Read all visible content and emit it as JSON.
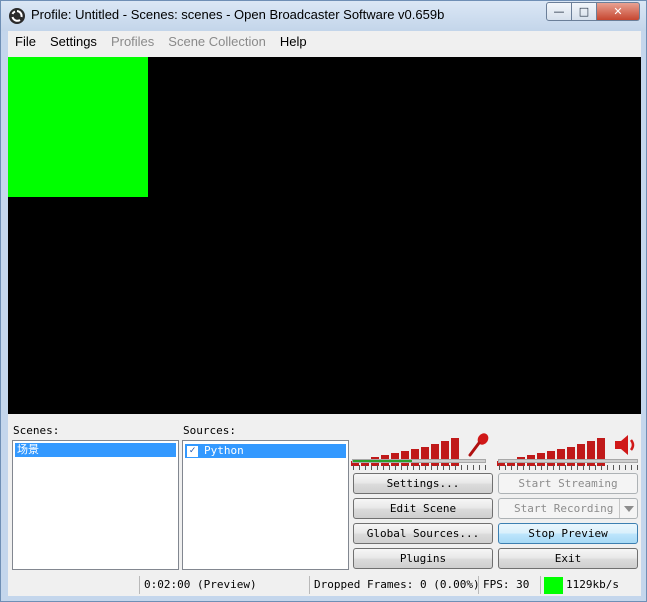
{
  "window": {
    "title": "Profile: Untitled - Scenes: scenes - Open Broadcaster Software v0.659b",
    "buttons": {
      "minimize": "—",
      "maximize": "□",
      "close": "✕"
    }
  },
  "menu": {
    "items": [
      {
        "label": "File",
        "enabled": true
      },
      {
        "label": "Settings",
        "enabled": true
      },
      {
        "label": "Profiles",
        "enabled": false
      },
      {
        "label": "Scene Collection",
        "enabled": false
      },
      {
        "label": "Help",
        "enabled": true
      }
    ]
  },
  "preview": {
    "background": "#000000",
    "source_color": "#00ff00"
  },
  "scenes": {
    "label": "Scenes:",
    "items": [
      "场景"
    ],
    "selected": 0
  },
  "sources": {
    "label": "Sources:",
    "items": [
      {
        "name": "Python",
        "checked": true
      }
    ]
  },
  "meters": {
    "mic": {
      "icon": "microphone-icon",
      "level": 0.45
    },
    "desktop": {
      "icon": "speaker-icon",
      "level": 0.0
    },
    "bar_color": "#c01a1a",
    "level_color": "#2aa02a"
  },
  "buttons": {
    "settings": "Settings...",
    "start_streaming": "Start Streaming",
    "edit_scene": "Edit Scene",
    "start_recording": "Start Recording",
    "global_sources": "Global Sources...",
    "stop_preview": "Stop Preview",
    "plugins": "Plugins",
    "exit": "Exit"
  },
  "status": {
    "time": "0:02:00",
    "mode": "(Preview)",
    "dropped_frames": "Dropped Frames: 0 (0.00%)",
    "fps": "FPS: 30",
    "bitrate": "1129kb/s",
    "indicator_color": "#00ff00"
  }
}
